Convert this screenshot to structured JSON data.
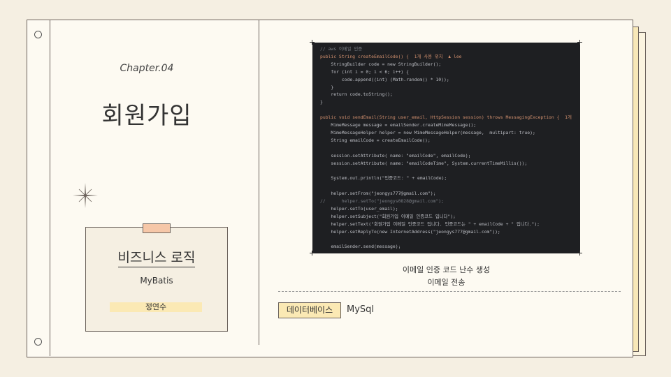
{
  "chapter_label": "Chapter.04",
  "page_title": "회원가입",
  "card": {
    "title": "비즈니스 로직",
    "subtitle": "MyBatis",
    "author": "정연수"
  },
  "code_lines": [
    {
      "t": "// aws 이메일 인증",
      "c": "#7a7e85"
    },
    {
      "t": "public String createEmailCode() {  1개 사용 위치  ♟ lee",
      "c": "#cf8e6d"
    },
    {
      "t": "    StringBuilder code = new StringBuilder();",
      "c": "#bcbec4"
    },
    {
      "t": "    for (int i = 0; i < 6; i++) {",
      "c": "#bcbec4"
    },
    {
      "t": "        code.append((int) (Math.random() * 10));",
      "c": "#bcbec4"
    },
    {
      "t": "    }",
      "c": "#bcbec4"
    },
    {
      "t": "    return code.toString();",
      "c": "#bcbec4"
    },
    {
      "t": "}",
      "c": "#bcbec4"
    },
    {
      "t": "",
      "c": "#bcbec4"
    },
    {
      "t": "public void sendEmail(String user_email, HttpSession session) throws MessagingException {  1개",
      "c": "#cf8e6d"
    },
    {
      "t": "    MimeMessage message = emailSender.createMimeMessage();",
      "c": "#bcbec4"
    },
    {
      "t": "    MimeMessageHelper helper = new MimeMessageHelper(message,  multipart: true);",
      "c": "#bcbec4"
    },
    {
      "t": "    String emailCode = createEmailCode();",
      "c": "#bcbec4"
    },
    {
      "t": "",
      "c": "#bcbec4"
    },
    {
      "t": "    session.setAttribute( name: \"emailCode\", emailCode);",
      "c": "#bcbec4"
    },
    {
      "t": "    session.setAttribute( name: \"emailCodeTime\", System.currentTimeMillis());",
      "c": "#bcbec4"
    },
    {
      "t": "",
      "c": "#bcbec4"
    },
    {
      "t": "    System.out.println(\"인증코드: \" + emailCode);",
      "c": "#bcbec4"
    },
    {
      "t": "",
      "c": "#bcbec4"
    },
    {
      "t": "    helper.setFrom(\"jeongys777@gmail.com\");",
      "c": "#bcbec4"
    },
    {
      "t": "//      helper.setTo(\"jeongys0828@gmail.com\");",
      "c": "#7a7e85"
    },
    {
      "t": "    helper.setTo(user_email);",
      "c": "#bcbec4"
    },
    {
      "t": "    helper.setSubject(\"회원가입 이메일 인증코드 입니다\");",
      "c": "#bcbec4"
    },
    {
      "t": "    helper.setText(\"회원가입 이메일 인증코드 입니다. 인증코드는 \" + emailCode + \" 입니다.\");",
      "c": "#bcbec4"
    },
    {
      "t": "    helper.setReplyTo(new InternetAddress(\"jeongys777@gmail.com\"));",
      "c": "#bcbec4"
    },
    {
      "t": "",
      "c": "#bcbec4"
    },
    {
      "t": "    emailSender.send(message);",
      "c": "#bcbec4"
    }
  ],
  "caption_line1": "이메일 인증 코드 난수 생성",
  "caption_line2": "이메일 전송",
  "database": {
    "label": "데이터베이스",
    "value": "MySql"
  }
}
